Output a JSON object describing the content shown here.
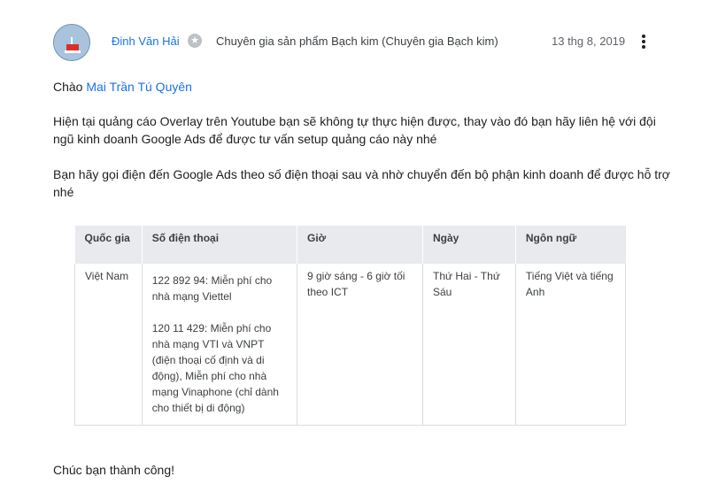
{
  "post": {
    "author": "Đinh Văn Hải",
    "role": "Chuyên gia sản phẩm Bạch kim (Chuyên gia Bạch kim)",
    "date": "13 thg 8, 2019",
    "badge_icon": "star-icon",
    "more_icon": "more-vert-icon"
  },
  "body": {
    "greeting_prefix": "Chào ",
    "greeting_name": "Mai Trần Tú Quyên",
    "para1": "Hiện tại quảng cáo Overlay trên Youtube bạn sẽ không tự thực hiện được, thay vào đó bạn hãy liên hệ với đội ngũ kinh doanh Google Ads để được tư vấn setup quảng cáo này nhé",
    "para2": "Bạn hãy gọi điện đến Google Ads theo số điện thoại sau và nhờ chuyển đến bộ phận kinh doanh để được hỗ trợ nhé",
    "closing": "Chúc bạn thành công!"
  },
  "table": {
    "headers": [
      "Quốc gia",
      "Số điện thoại",
      "Giờ",
      "Ngày",
      "Ngôn ngữ"
    ],
    "row": {
      "country": "Việt Nam",
      "phone1": "122 892 94: Miễn phí cho nhà mạng Viettel",
      "phone2": "120 11 429: Miễn phí cho nhà mạng VTI và VNPT (điện thoại cố định và di động), Miễn phí cho nhà mạng Vinaphone (chỉ dành cho thiết bị di động)",
      "hours": "9 giờ sáng - 6 giờ tối theo ICT",
      "days": "Thứ Hai - Thứ Sáu",
      "language": "Tiếng Việt và tiếng Anh"
    }
  },
  "colors": {
    "link": "#1a73e8",
    "text": "#202124",
    "table_header_bg": "#e8eaed"
  }
}
